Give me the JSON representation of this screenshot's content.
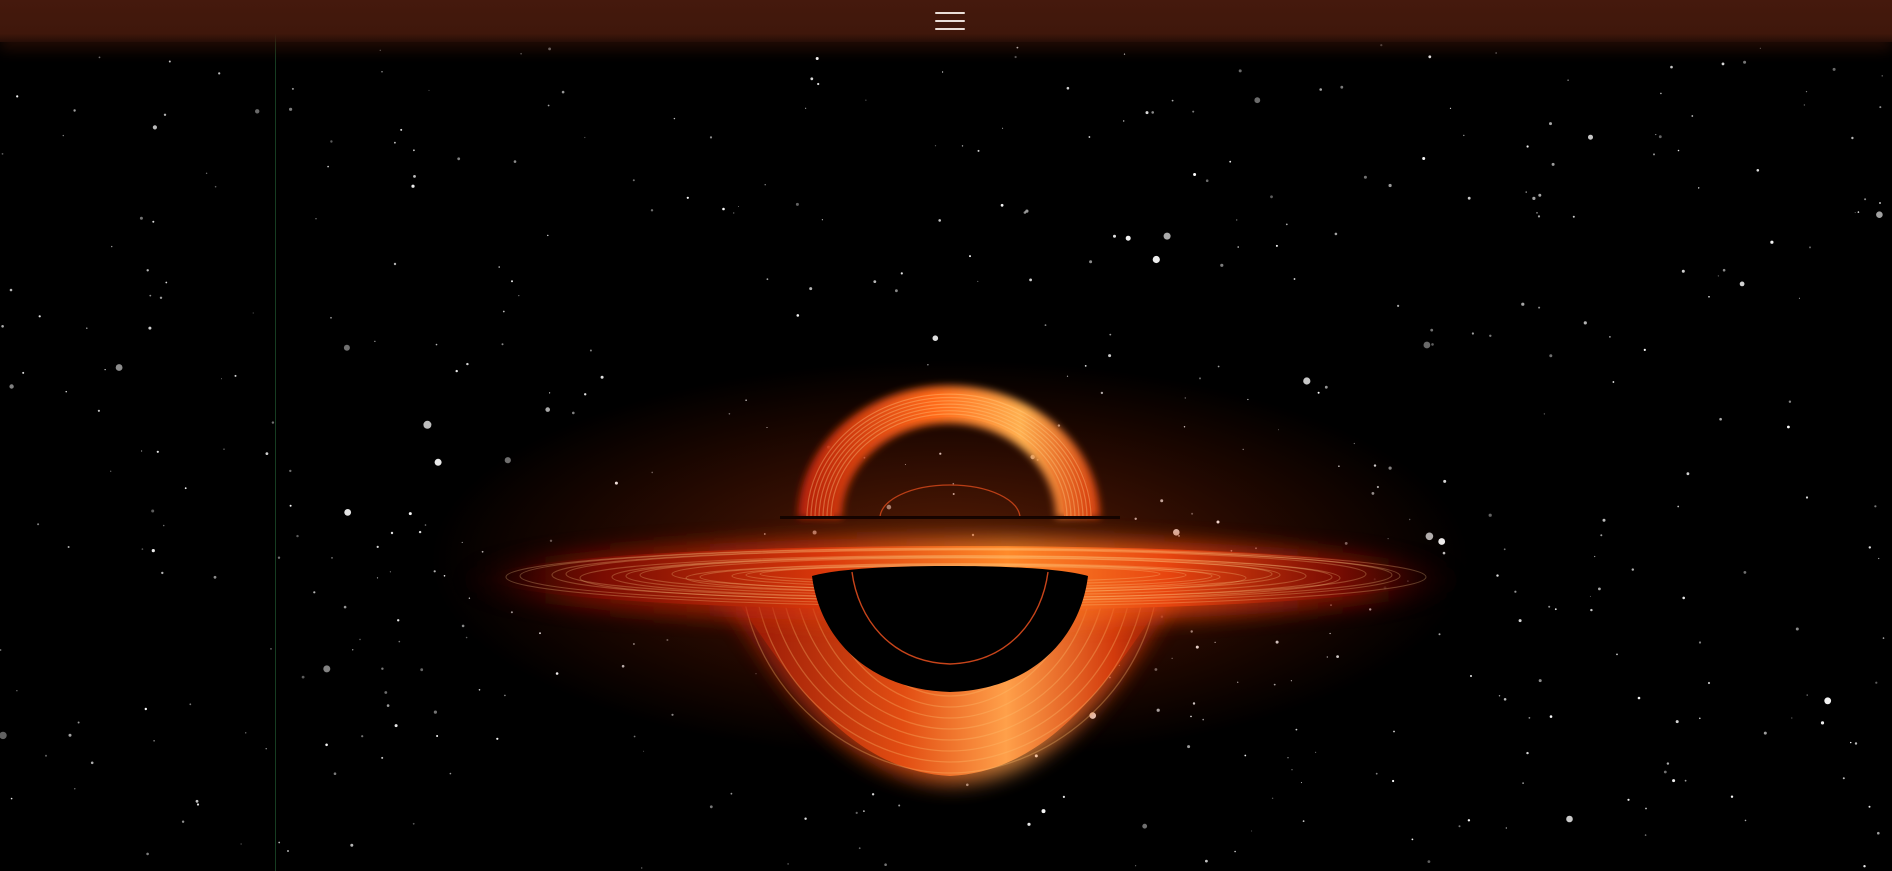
{
  "header": {
    "menu_icon": "hamburger-menu-icon",
    "bar_color": "#431a0c",
    "icon_color": "#e9ded8"
  },
  "scene": {
    "subject": "black-hole-accretion-disk",
    "background_color": "#000000",
    "disk_colors": [
      "#ffb35a",
      "#ff7a1a",
      "#e0400e",
      "#a01505",
      "#4a0400"
    ]
  }
}
